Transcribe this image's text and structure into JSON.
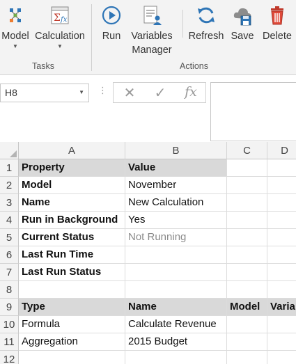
{
  "ribbon": {
    "groups": [
      {
        "label": "Tasks"
      },
      {
        "label": "Actions"
      }
    ],
    "buttons": {
      "model": {
        "label": "Model",
        "icon": "model-icon"
      },
      "calculation": {
        "label": "Calculation",
        "icon": "calculation-icon"
      },
      "run": {
        "label": "Run",
        "icon": "run-icon"
      },
      "variables_manager": {
        "label_line1": "Variables",
        "label_line2": "Manager",
        "icon": "variables-manager-icon"
      },
      "refresh": {
        "label": "Refresh",
        "icon": "refresh-icon"
      },
      "save": {
        "label": "Save",
        "icon": "save-icon"
      },
      "delete": {
        "label": "Delete",
        "icon": "delete-icon"
      }
    },
    "colors": {
      "accent_blue": "#2e75b6",
      "delete_red": "#c0392b"
    }
  },
  "formula_bar": {
    "name_box": "H8",
    "cancel_symbol": "✕",
    "enter_symbol": "✓",
    "fx_symbol": "fx",
    "formula": ""
  },
  "grid": {
    "columns": [
      "A",
      "B",
      "C",
      "D"
    ],
    "rows": [
      "1",
      "2",
      "3",
      "4",
      "5",
      "6",
      "7",
      "8",
      "9",
      "10",
      "11",
      "12"
    ],
    "cells": {
      "A1": "Property",
      "B1": "Value",
      "A2": "Model",
      "B2": "November",
      "A3": "Name",
      "B3": "New Calculation",
      "A4": "Run in Background",
      "B4": "Yes",
      "A5": "Current Status",
      "B5": "Not Running",
      "A6": "Last Run Time",
      "B6": "",
      "A7": "Last Run Status",
      "B7": "",
      "A9": "Type",
      "B9": "Name",
      "C9": "Model",
      "D9": "Varia",
      "A10": "Formula",
      "B10": "Calculate Revenue",
      "A11": "Aggregation",
      "B11": "2015 Budget"
    },
    "header_fill": "#d9d9d9"
  }
}
